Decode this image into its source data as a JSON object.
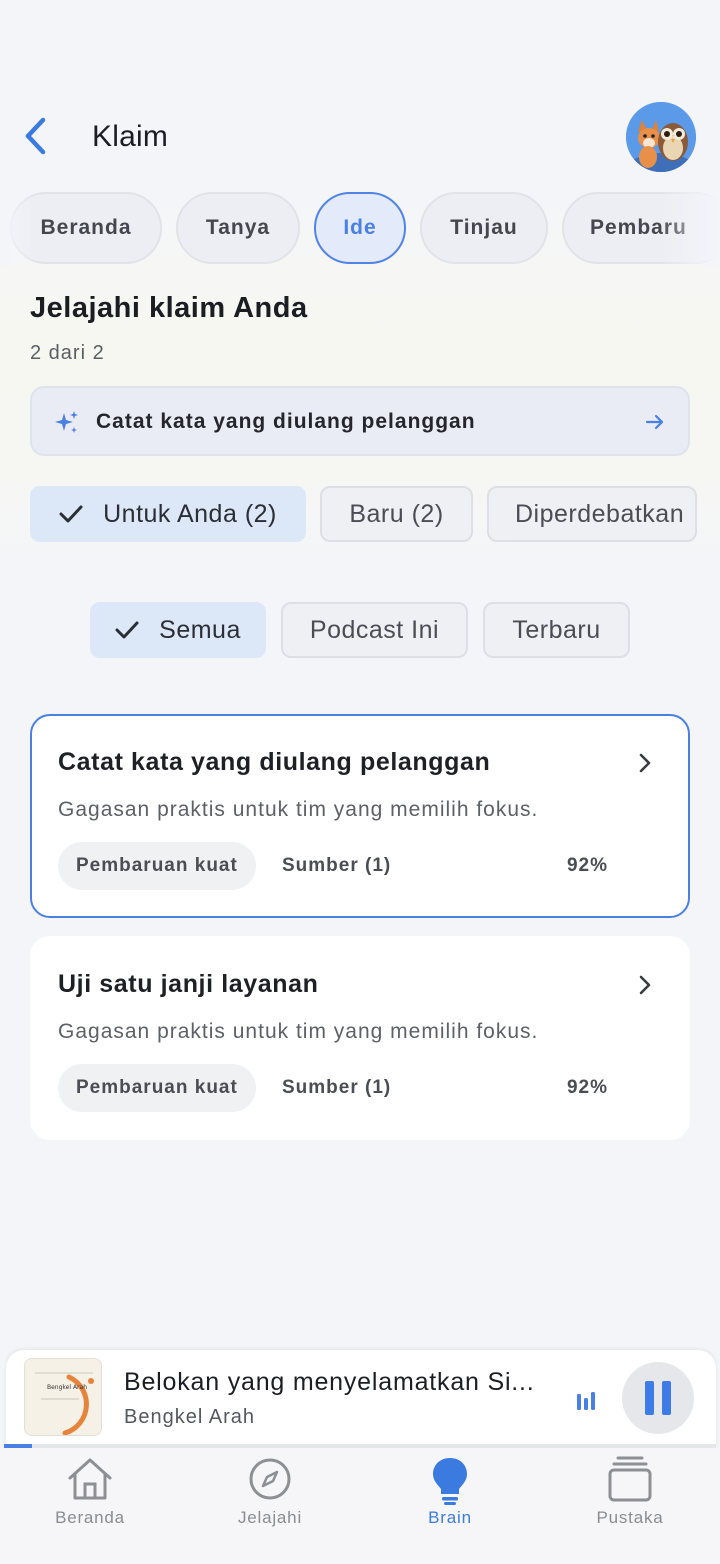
{
  "header": {
    "title": "Klaim"
  },
  "tabs": [
    {
      "label": "Beranda",
      "active": false
    },
    {
      "label": "Tanya",
      "active": false
    },
    {
      "label": "Ide",
      "active": true
    },
    {
      "label": "Tinjau",
      "active": false
    },
    {
      "label": "Pembaru",
      "active": false
    }
  ],
  "section": {
    "title": "Jelajahi klaim Anda",
    "count": "2 dari 2"
  },
  "suggestion": {
    "label": "Catat kata yang diulang pelanggan"
  },
  "filters_primary": [
    {
      "label": "Untuk Anda (2)",
      "selected": true
    },
    {
      "label": "Baru (2)",
      "selected": false
    },
    {
      "label": "Diperdebatkan",
      "selected": false
    }
  ],
  "filters_secondary": [
    {
      "label": "Semua",
      "selected": true
    },
    {
      "label": "Podcast Ini",
      "selected": false
    },
    {
      "label": "Terbaru",
      "selected": false
    }
  ],
  "claims": [
    {
      "title": "Catat kata yang diulang pelanggan",
      "subtitle": "Gagasan praktis untuk tim yang memilih fokus.",
      "tag": "Pembaruan kuat",
      "sources": "Sumber (1)",
      "score": "92%"
    },
    {
      "title": "Uji satu janji layanan",
      "subtitle": "Gagasan praktis untuk tim yang memilih fokus.",
      "tag": "Pembaruan kuat",
      "sources": "Sumber (1)",
      "score": "92%"
    }
  ],
  "player": {
    "title": "Belokan yang menyelamatkan Si...",
    "subtitle": "Bengkel Arah",
    "art_text": "Bengkel Arah",
    "progress": 0.04
  },
  "nav": [
    {
      "label": "Beranda",
      "icon": "home-icon",
      "active": false
    },
    {
      "label": "Jelajahi",
      "icon": "compass-icon",
      "active": false
    },
    {
      "label": "Brain",
      "icon": "lightbulb-icon",
      "active": true
    },
    {
      "label": "Pustaka",
      "icon": "library-icon",
      "active": false
    }
  ],
  "colors": {
    "accent": "#4a7fe4",
    "background": "#f4f5f9",
    "card": "#ffffff"
  }
}
